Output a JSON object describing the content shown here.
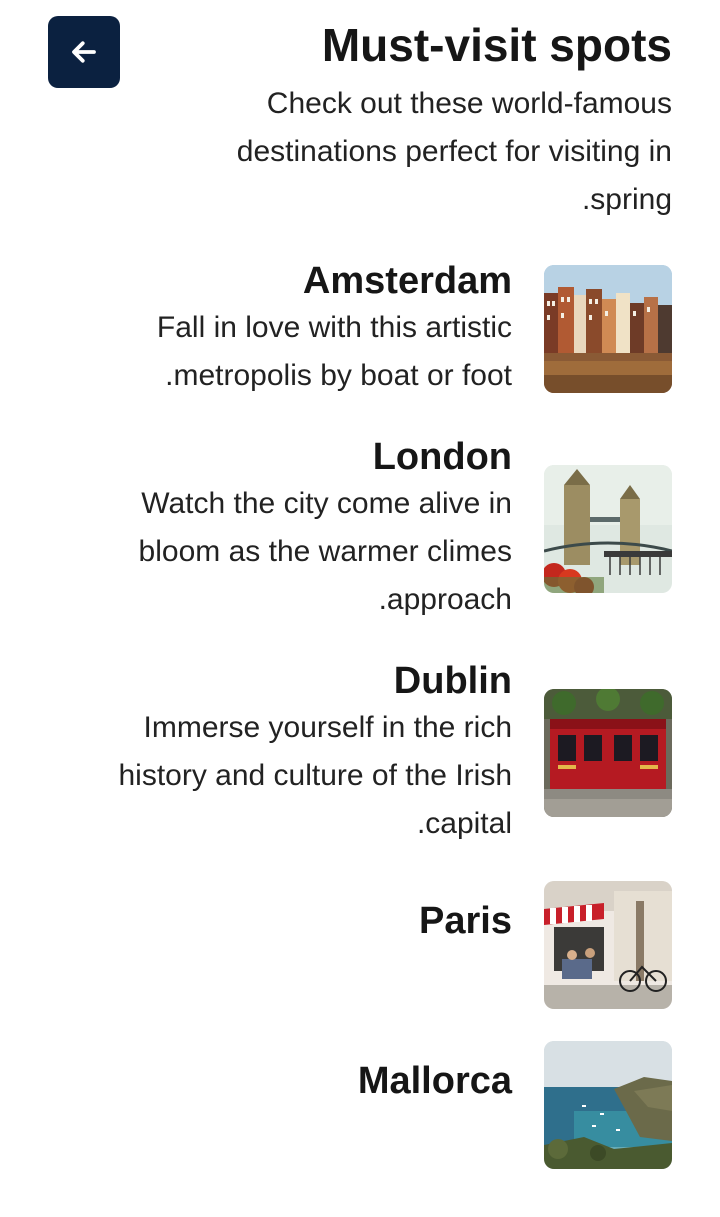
{
  "header": {
    "back_icon": "arrow-left-icon",
    "title": "Must-visit spots",
    "subtitle": "Check out these world-famous destinations perfect for visiting in .spring"
  },
  "destinations": [
    {
      "name": "Amsterdam",
      "description": "Fall in love with this artistic .metropolis by boat or foot",
      "image": "amsterdam-canal-houses"
    },
    {
      "name": "London",
      "description": "Watch the city come alive in bloom as the warmer climes .approach",
      "image": "london-tower-bridge"
    },
    {
      "name": "Dublin",
      "description": "Immerse yourself in the rich history and culture of the Irish .capital",
      "image": "dublin-red-pub"
    },
    {
      "name": "Paris",
      "description": "",
      "image": "paris-cafe-street"
    },
    {
      "name": "Mallorca",
      "description": "",
      "image": "mallorca-coast"
    }
  ],
  "colors": {
    "back_button_bg": "#0b2140",
    "text": "#161616"
  }
}
